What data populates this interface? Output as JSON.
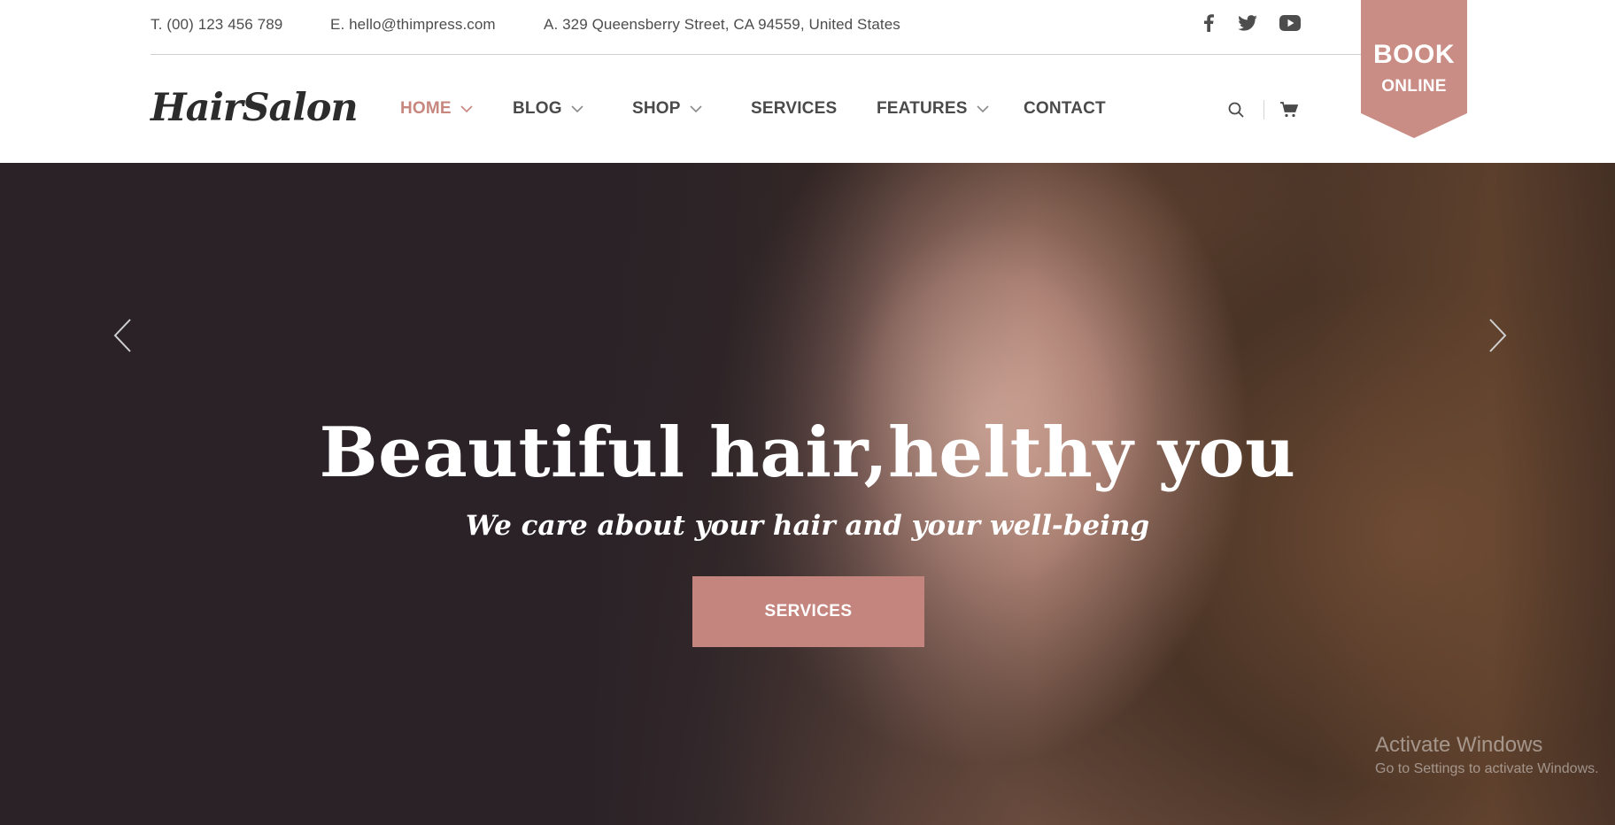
{
  "topbar": {
    "phone": "T. (00) 123 456 789",
    "email": "E. hello@thimpress.com",
    "address": "A. 329 Queensberry Street, CA 94559, United States",
    "social": [
      "facebook-icon",
      "twitter-icon",
      "youtube-icon"
    ]
  },
  "header": {
    "logo": "HairSalon",
    "nav": [
      {
        "label": "HOME",
        "active": true,
        "has_dropdown": true
      },
      {
        "label": "BLOG",
        "active": false,
        "has_dropdown": true
      },
      {
        "label": "SHOP",
        "active": false,
        "has_dropdown": true
      },
      {
        "label": "SERVICES",
        "active": false,
        "has_dropdown": false
      },
      {
        "label": "FEATURES",
        "active": false,
        "has_dropdown": true
      },
      {
        "label": "CONTACT",
        "active": false,
        "has_dropdown": false
      }
    ],
    "icons": [
      "search-icon",
      "cart-icon"
    ]
  },
  "book": {
    "line1": "BOOK",
    "line2": "ONLINE"
  },
  "hero": {
    "title": "Beautiful hair,helthy you",
    "subtitle": "We care about your hair and your well-being",
    "button": "SERVICES"
  },
  "watermark": {
    "line1": "Activate Windows",
    "line2": "Go to Settings to activate Windows."
  },
  "colors": {
    "accent": "#c4857e",
    "dark_bg": "#2a2227",
    "nav_text": "#4a4a4a"
  }
}
